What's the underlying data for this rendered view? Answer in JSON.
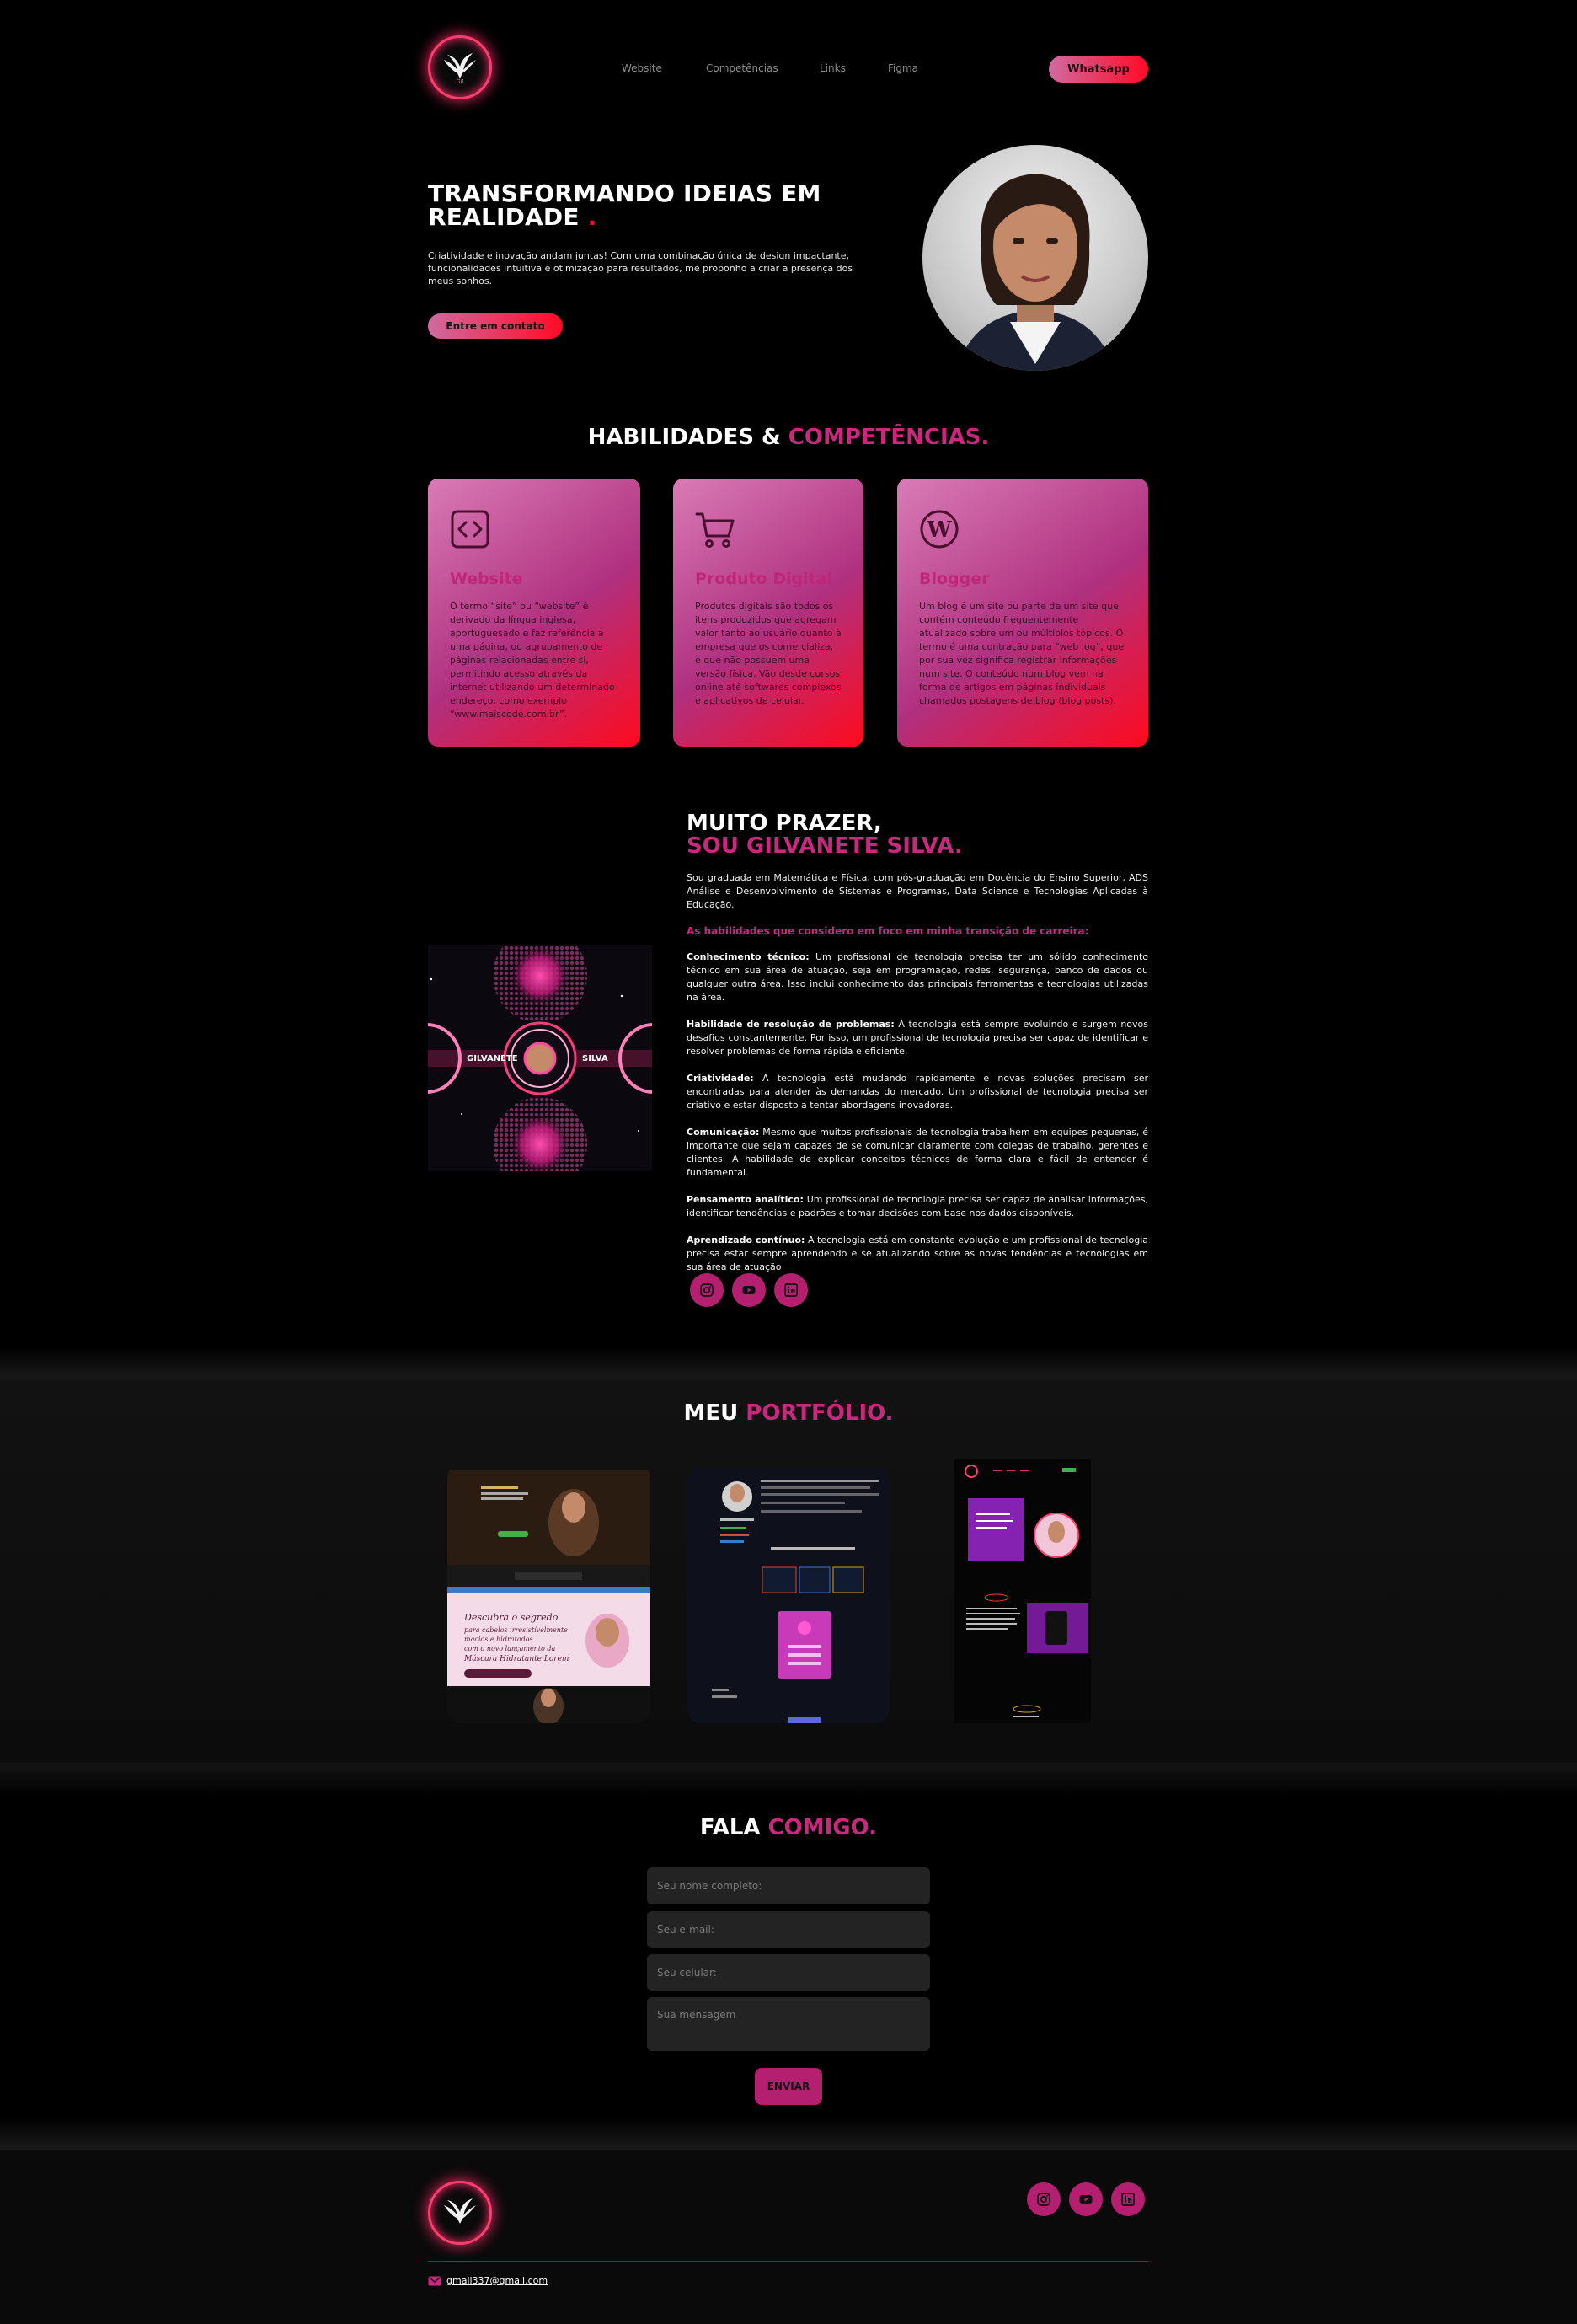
{
  "nav": {
    "links": [
      "Website",
      "Competências",
      "Links",
      "Figma"
    ],
    "cta": "Whatsapp"
  },
  "hero": {
    "title_line1": "TRANSFORMANDO IDEIAS EM",
    "title_line2": "REALIDADE",
    "title_dot": ".",
    "text": "Criatividade e inovação andam juntas! Com uma combinação única de design impactante, funcionalidades intuitiva e otimização para resultados, me proponho a criar a presença dos meus sonhos.",
    "cta": "Entre em contato"
  },
  "skills": {
    "title_white": "HABILIDADES &",
    "title_pink": "COMPETÊNCIAS.",
    "cards": [
      {
        "icon": "code-icon",
        "title": "Website",
        "text": "O termo “site” ou “website” é derivado da língua inglesa, aportuguesado e faz referência a uma página, ou agrupamento de páginas relacionadas entre si, permitindo acesso através da internet utilizando um determinado endereço, como exemplo “www.maiscode.com.br”."
      },
      {
        "icon": "cart-icon",
        "title": "Produto Digital",
        "text": "Produtos digitais são todos os itens produzidos que agregam valor tanto ao usuário quanto à empresa que os comercializa, e que não possuem uma versão física. Vão desde cursos online até softwares complexos e aplicativos de celular."
      },
      {
        "icon": "wordpress-icon",
        "title": "Blogger",
        "text": "Um blog é um site ou parte de um site que contém conteúdo frequentemente atualizado sobre um ou múltiplos tópicos. O termo é uma contração para “web log”, que por sua vez significa registrar informações num site. O conteúdo num blog vem na forma de artigos em páginas individuais chamados postagens de blog (blog posts)."
      }
    ]
  },
  "about": {
    "title_white": "MUITO PRAZER,",
    "title_pink": "SOU GILVANETE SILVA.",
    "intro": "Sou graduada em Matemática e Física, com pós-graduação em Docência do Ensino Superior, ADS Análise e Desenvolvimento de Sistemas e Programas, Data Science e Tecnologias Aplicadas à Educação.",
    "subtitle": "As habilidades que considero em foco em minha transição de carreira:",
    "items": [
      {
        "label": "Conhecimento técnico:",
        "text": " Um profissional de tecnologia precisa ter um sólido conhecimento técnico em sua área de atuação, seja em programação, redes, segurança, banco de dados ou qualquer outra área. Isso inclui conhecimento das principais ferramentas e tecnologias utilizadas na área."
      },
      {
        "label": "Habilidade de resolução de problemas:",
        "text": " A tecnologia está sempre evoluindo e surgem novos desafios constantemente. Por isso, um profissional de tecnologia precisa ser capaz de identificar e resolver problemas de forma rápida e eficiente."
      },
      {
        "label": "Criatividade:",
        "text": " A tecnologia está mudando rapidamente e novas soluções precisam ser encontradas para atender às demandas do mercado. Um profissional de tecnologia precisa ser criativo e estar disposto a tentar abordagens inovadoras."
      },
      {
        "label": "Comunicação:",
        "text": " Mesmo que muitos profissionais de tecnologia trabalhem em equipes pequenas, é importante que sejam capazes de se comunicar claramente com colegas de trabalho, gerentes e clientes. A habilidade de explicar conceitos técnicos de forma clara e fácil de entender é fundamental."
      },
      {
        "label": "Pensamento analítico:",
        "text": " Um profissional de tecnologia precisa ser capaz de analisar informações, identificar tendências e padrões e tomar decisões com base nos dados disponíveis."
      },
      {
        "label": "Aprendizado contínuo:",
        "text": " A tecnologia está em constante evolução e um profissional de tecnologia precisa estar sempre aprendendo e se atualizando sobre as novas tendências e tecnologias em sua área de atuação"
      }
    ],
    "banner_left": "GILVANETE",
    "banner_right": "SILVA"
  },
  "portfolio": {
    "title_white": "MEU",
    "title_pink": "PORTFÓLIO."
  },
  "contact": {
    "title_white": "FALA",
    "title_pink": "COMIGO.",
    "name_placeholder": "Seu nome completo:",
    "email_placeholder": "Seu e-mail:",
    "phone_placeholder": "Seu celular:",
    "message_placeholder": "Sua mensagem",
    "send": "ENVIAR"
  },
  "footer": {
    "email": "gmail337@gmail.com"
  },
  "colors": {
    "accent": "#c8287e",
    "gradient_start": "#d06aa0",
    "gradient_end": "#ff0a26",
    "background": "#000000"
  }
}
